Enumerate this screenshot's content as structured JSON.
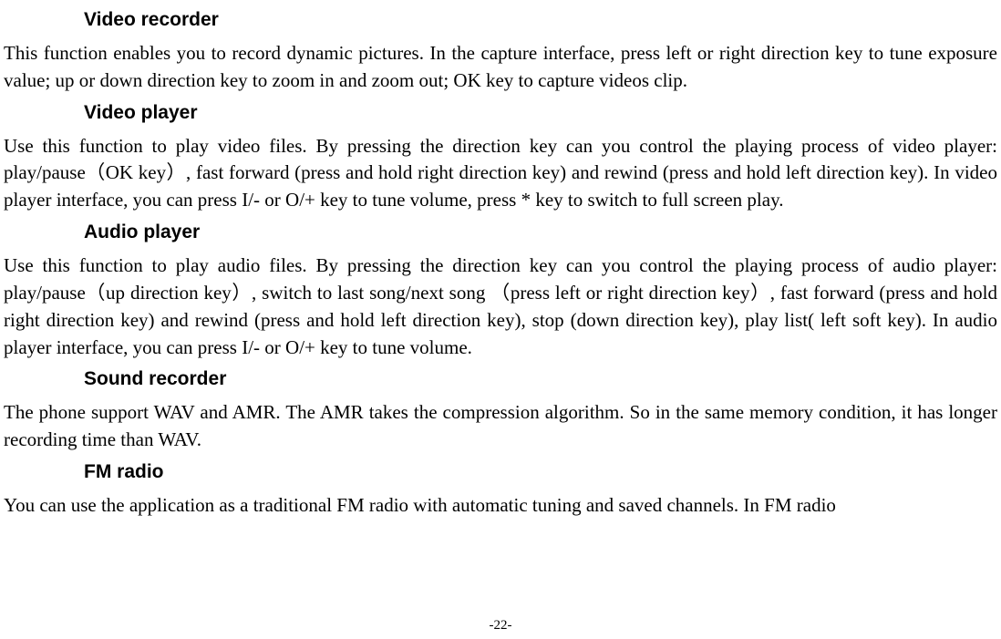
{
  "sections": {
    "video_recorder": {
      "heading": "Video recorder",
      "body": "This function enables you to record dynamic pictures. In the capture interface, press left or right direction key to tune exposure value; up or down direction key to zoom in and zoom out; OK key to capture videos clip."
    },
    "video_player": {
      "heading": "Video player",
      "body": "Use this function to play video files. By pressing the direction key can you control the playing process of video player: play/pause（OK key）, fast forward (press and hold right direction key) and rewind (press and hold left direction key). In video player interface, you can press I/- or O/+ key to tune volume, press * key to switch to full screen play."
    },
    "audio_player": {
      "heading": "Audio player",
      "body": "Use this function to play audio files. By pressing the direction key can you control the playing process of audio player: play/pause（up direction key）, switch to last song/next song （press left or right direction key）, fast forward (press and hold right direction key) and rewind (press and hold left direction key), stop (down direction key), play list( left soft key). In audio player interface, you can press I/- or O/+ key to tune volume."
    },
    "sound_recorder": {
      "heading": "Sound recorder",
      "body": "The phone support WAV and AMR. The AMR takes the compression algorithm. So in the same memory condition, it has longer recording time than WAV."
    },
    "fm_radio": {
      "heading": "FM radio",
      "body": "You can use the application as a traditional FM radio with automatic tuning and saved channels. In FM radio"
    }
  },
  "page_number": "-22-"
}
